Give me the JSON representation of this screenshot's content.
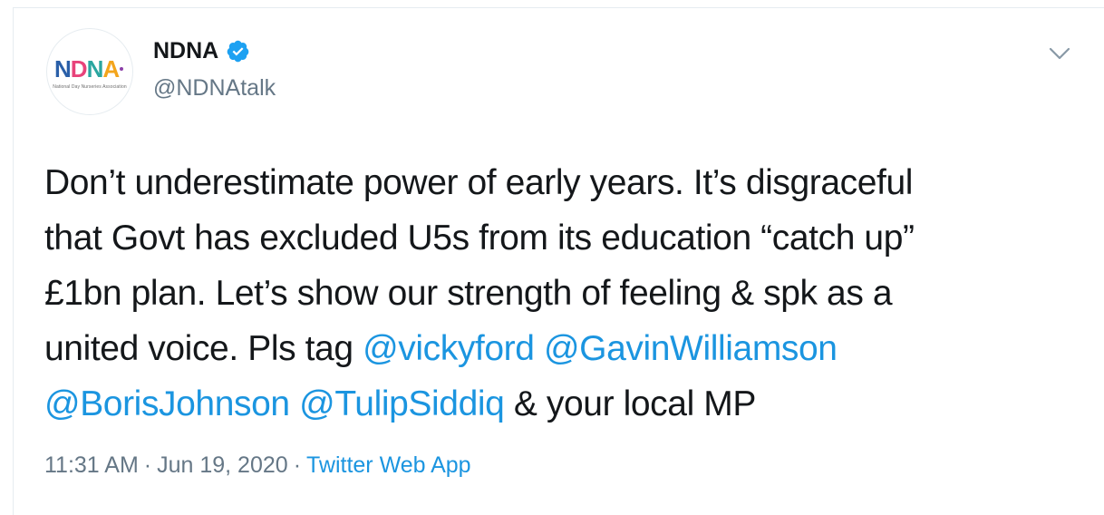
{
  "author": {
    "display_name": "NDNA",
    "handle": "@NDNAtalk",
    "verified": true,
    "avatar_logo_text": "NDNA",
    "avatar_tagline": "National Day Nurseries Association"
  },
  "tweet": {
    "lines": [
      [
        {
          "t": "Don’t underestimate power of early years. It’s disgraceful",
          "m": false
        }
      ],
      [
        {
          "t": "that Govt has excluded U5s from its education “catch up”",
          "m": false
        }
      ],
      [
        {
          "t": "£1bn plan. Let’s show our strength of feeling & spk as a",
          "m": false
        }
      ],
      [
        {
          "t": "united voice. Pls tag ",
          "m": false
        },
        {
          "t": "@vickyford",
          "m": true
        },
        {
          "t": " ",
          "m": false
        },
        {
          "t": "@GavinWilliamson",
          "m": true
        }
      ],
      [
        {
          "t": "@BorisJohnson",
          "m": true
        },
        {
          "t": " ",
          "m": false
        },
        {
          "t": "@TulipSiddiq",
          "m": true
        },
        {
          "t": " & your local MP",
          "m": false
        }
      ]
    ],
    "mentions": [
      "@vickyford",
      "@GavinWilliamson",
      "@BorisJohnson",
      "@TulipSiddiq"
    ]
  },
  "meta": {
    "time": "11:31 AM",
    "separator": "·",
    "date": "Jun 19, 2020",
    "source": "Twitter Web App"
  },
  "icons": {
    "verified": "verified-badge-icon",
    "caret": "chevron-down-icon"
  },
  "colors": {
    "link": "#1b95e0",
    "secondary_text": "#657786",
    "verified": "#1da1f2",
    "border": "#e6ecf0"
  }
}
